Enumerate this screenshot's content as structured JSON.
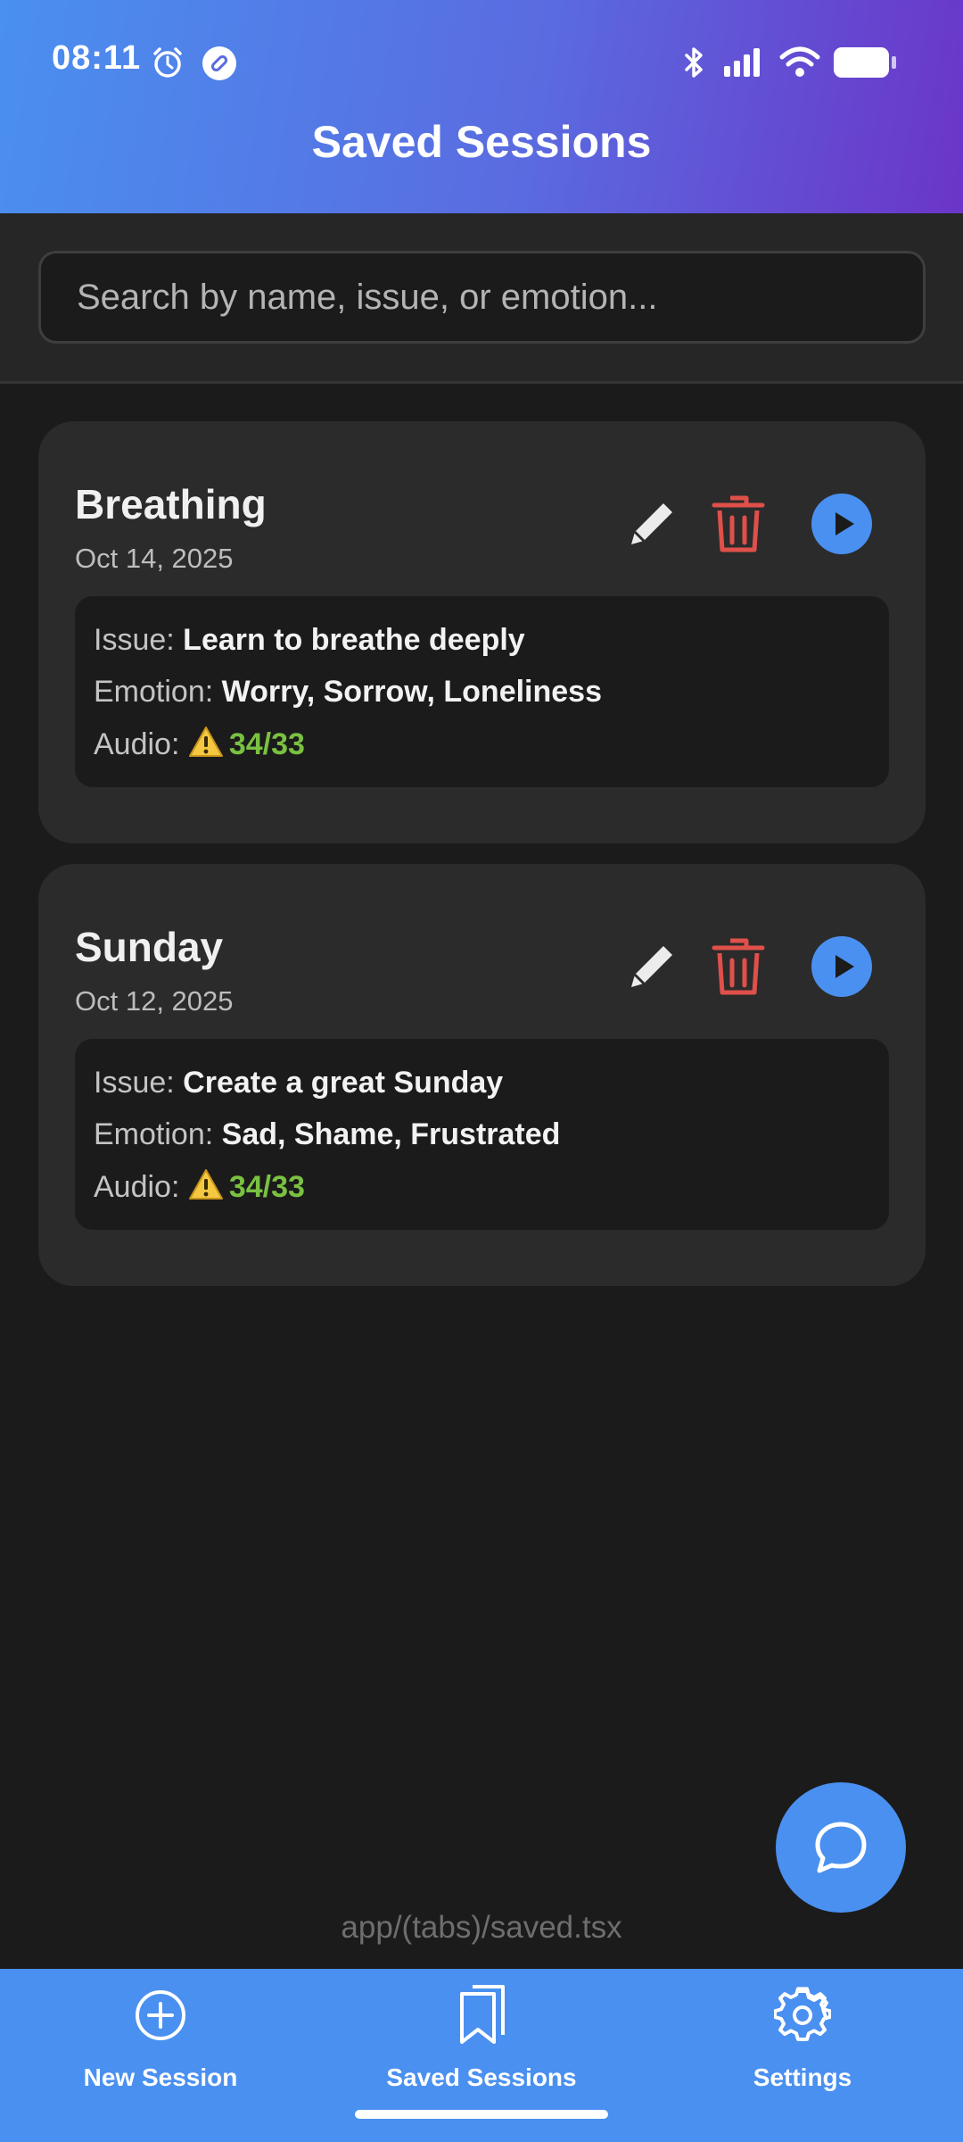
{
  "status_bar": {
    "time": "08:11"
  },
  "header": {
    "title": "Saved Sessions"
  },
  "search": {
    "placeholder": "Search by name, issue, or emotion..."
  },
  "labels": {
    "issue": "Issue:",
    "emotion": "Emotion:",
    "audio": "Audio:"
  },
  "sessions": [
    {
      "name": "Breathing",
      "date": "Oct 14, 2025",
      "issue": "Learn to breathe deeply",
      "emotion": "Worry, Sorrow, Loneliness",
      "audio": "34/33"
    },
    {
      "name": "Sunday",
      "date": "Oct 12, 2025",
      "issue": "Create a great Sunday",
      "emotion": "Sad, Shame, Frustrated",
      "audio": "34/33"
    }
  ],
  "route_label": "app/(tabs)/saved.tsx",
  "tabs": [
    {
      "label": "New Session",
      "icon": "plus-circle-icon"
    },
    {
      "label": "Saved Sessions",
      "icon": "bookmarks-icon"
    },
    {
      "label": "Settings",
      "icon": "gear-icon"
    }
  ],
  "colors": {
    "accent": "#4a90f0",
    "header_gradient_end": "#6b35c8",
    "delete": "#e0504a",
    "audio_ok": "#7ac142",
    "background": "#1b1b1b",
    "card": "#2b2b2b"
  }
}
